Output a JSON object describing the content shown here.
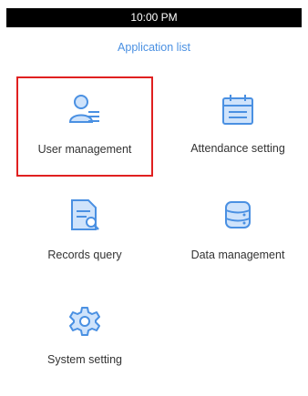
{
  "status_bar": {
    "time": "10:00 PM"
  },
  "header": {
    "title": "Application list"
  },
  "apps": [
    {
      "label": "User management",
      "icon": "user-list-icon",
      "selected": true
    },
    {
      "label": "Attendance setting",
      "icon": "calendar-icon",
      "selected": false
    },
    {
      "label": "Records query",
      "icon": "document-search-icon",
      "selected": false
    },
    {
      "label": "Data management",
      "icon": "database-icon",
      "selected": false
    },
    {
      "label": "System setting",
      "icon": "gear-icon",
      "selected": false
    }
  ],
  "colors": {
    "accent": "#4a90e2",
    "icon_light": "#cfe3fb",
    "selection_border": "#e02020",
    "status_bar_bg": "#000000"
  }
}
